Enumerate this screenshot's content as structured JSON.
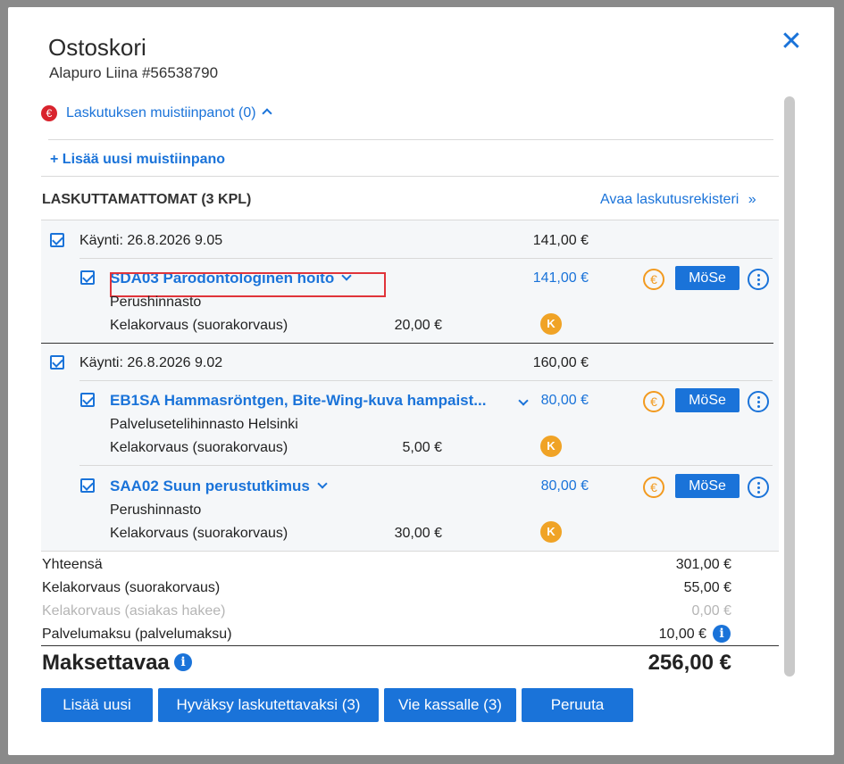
{
  "dialog": {
    "title": "Ostoskori",
    "subtitle": "Alapuro Liina #56538790",
    "close_icon": "close-icon"
  },
  "notes": {
    "toggle_label": "Laskutuksen muistiinpanot (0)",
    "add_label": "+ Lisää uusi muistiinpano"
  },
  "unbilled": {
    "heading": "LASKUTTAMATTOMAT (3 KPL)",
    "register_link": "Avaa laskutusrekisteri"
  },
  "visits": [
    {
      "label": "Käynti: 26.8.2026 9.05",
      "amount": "141,00 €",
      "items": [
        {
          "title": "SDA03 Parodontologinen hoito",
          "price": "141,00 €",
          "pricelist": "Perushinnasto",
          "kela_label": "Kelakorvaus (suorakorvaus)",
          "kela_amount": "20,00 €",
          "mose": "MöSe"
        }
      ]
    },
    {
      "label": "Käynti: 26.8.2026 9.02",
      "amount": "160,00 €",
      "items": [
        {
          "title": "EB1SA Hammasröntgen, Bite-Wing-kuva hampaist...",
          "price": "80,00 €",
          "pricelist": "Palvelusetelihinnasto Helsinki",
          "kela_label": "Kelakorvaus (suorakorvaus)",
          "kela_amount": "5,00 €",
          "mose": "MöSe"
        },
        {
          "title": "SAA02 Suun perustutkimus",
          "price": "80,00 €",
          "pricelist": "Perushinnasto",
          "kela_label": "Kelakorvaus (suorakorvaus)",
          "kela_amount": "30,00 €",
          "mose": "MöSe"
        }
      ]
    }
  ],
  "totals": {
    "total_label": "Yhteensä",
    "total_value": "301,00 €",
    "kela_direct_label": "Kelakorvaus (suorakorvaus)",
    "kela_direct_value": "55,00 €",
    "kela_customer_label": "Kelakorvaus (asiakas hakee)",
    "kela_customer_value": "0,00 €",
    "service_fee_label": "Palvelumaksu (palvelumaksu)",
    "service_fee_value": "10,00 €",
    "payable_label": "Maksettavaa",
    "payable_value": "256,00 €"
  },
  "buttons": {
    "add_new": "Lisää uusi",
    "approve": "Hyväksy laskutettavaksi (3)",
    "checkout": "Vie kassalle (3)",
    "cancel": "Peruuta"
  },
  "colors": {
    "accent": "#1a73d9",
    "kela": "#f0a326",
    "alert": "#d9232d"
  }
}
